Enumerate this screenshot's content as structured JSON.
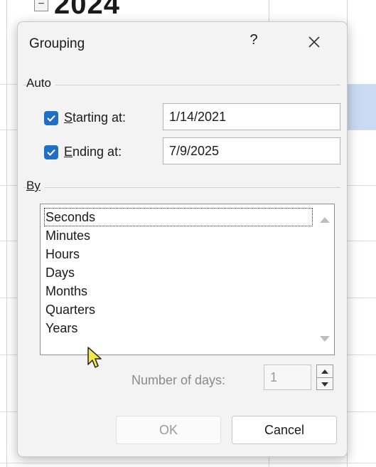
{
  "background": {
    "heading": "2024",
    "expander_symbol": "−"
  },
  "dialog": {
    "title": "Grouping",
    "help_label": "?",
    "auto_label": "Auto",
    "starting_at": {
      "label_mnemonic": "S",
      "label_rest": "tarting at:",
      "checked": true,
      "value": "1/14/2021"
    },
    "ending_at": {
      "label_mnemonic": "E",
      "label_rest": "nding at:",
      "checked": true,
      "value": "7/9/2025"
    },
    "by_label": "By",
    "by_options": [
      "Seconds",
      "Minutes",
      "Hours",
      "Days",
      "Months",
      "Quarters",
      "Years"
    ],
    "number_of_days_label": "Number of days:",
    "number_of_days_value": "1",
    "ok_label": "OK",
    "cancel_label": "Cancel"
  },
  "colors": {
    "accent": "#1f6fc7",
    "selected_cell": "#c9daf2"
  }
}
